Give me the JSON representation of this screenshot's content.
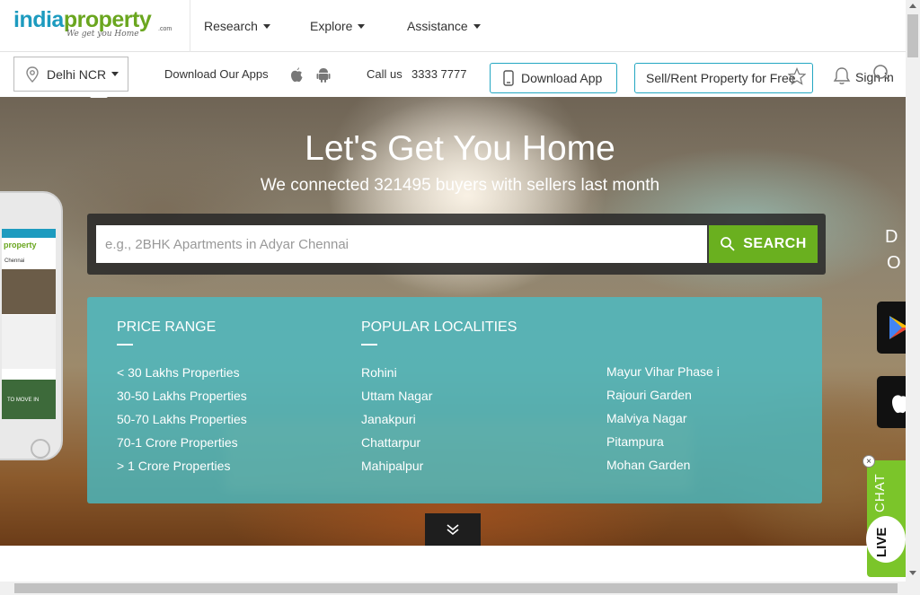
{
  "header": {
    "logo_primary": "india",
    "logo_secondary": "property",
    "logo_suffix": ".com",
    "logo_tagline": "We get you Home",
    "nav": [
      {
        "label": "Research"
      },
      {
        "label": "Explore"
      },
      {
        "label": "Assistance"
      }
    ]
  },
  "subbar": {
    "city": "Delhi NCR",
    "apps_label": "Download Our Apps",
    "call_label": "Call us",
    "phone": "3333 7777",
    "download_button": "Download App",
    "sell_button": "Sell/Rent Property for Free",
    "signin": "Sign in",
    "accent": "#23a7c2"
  },
  "hero": {
    "title": "Let's Get You Home",
    "subtitle": "We connected 321495 buyers with sellers last month",
    "search_placeholder": "e.g., 2BHK Apartments in Adyar Chennai",
    "search_button": "SEARCH",
    "search_button_color": "#6ab01f"
  },
  "panel": {
    "price_heading": "PRICE RANGE",
    "price_links": [
      "< 30 Lakhs Properties",
      "30-50 Lakhs Properties",
      "50-70 Lakhs Properties",
      "70-1 Crore Properties",
      "> 1 Crore Properties"
    ],
    "localities_heading": "POPULAR LOCALITIES",
    "localities_col1": [
      "Rohini",
      "Uttam Nagar",
      "Janakpuri",
      "Chattarpur",
      "Mahipalpur"
    ],
    "localities_col2": [
      "Mayur Vihar Phase i",
      "Rajouri Garden",
      "Malviya Nagar",
      "Pitampura",
      "Mohan Garden"
    ]
  },
  "side": {
    "right_text_1": "D",
    "right_text_2": "O",
    "live_chat_1": "LIVE",
    "live_chat_2": "CHAT"
  },
  "phone_mock": {
    "brand": "property",
    "city": "Chennai",
    "move_text": "TO MOVE IN"
  }
}
